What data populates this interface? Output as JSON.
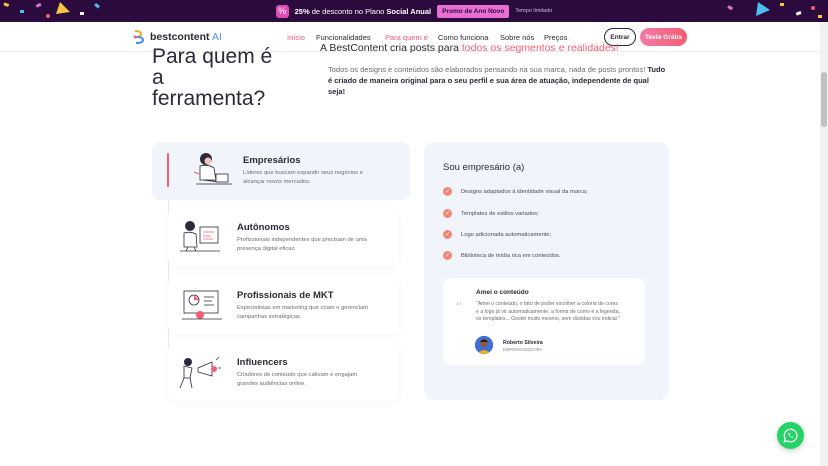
{
  "promo": {
    "text_pct": "25%",
    "text_mid": " de desconto no Plano ",
    "text_plan": "Social Anual",
    "button": "Promo de Ano Novo",
    "limited": "Tempo limitado"
  },
  "header": {
    "logo_name": "bestcontent",
    "logo_suffix": " AI",
    "nav": [
      {
        "label": "Início",
        "active": true
      },
      {
        "label": "Funcionalidades",
        "active": false
      },
      {
        "label": "Para quem é",
        "active": true
      },
      {
        "label": "Como funciona",
        "active": false
      },
      {
        "label": "Sobre nós",
        "active": false
      },
      {
        "label": "Preços",
        "active": false
      }
    ],
    "enter_label": "Entrar",
    "trial_label": "Teste Grátis"
  },
  "hero": {
    "title_l1": "Para quem é",
    "title_l2": "a",
    "title_l3": "ferramenta?",
    "cut_text": "A BestContent cria posts para ",
    "cut_highlight": "todos os segmentos e realidades!",
    "p1": "Todos os designs e conteúdos são elaborados pensando na sua marca, nada de posts prontos! ",
    "p1_bold": "Tudo",
    "p2": "é criado de maneira original para o seu perfil e sua área de atuação, independente de qual seja!"
  },
  "profiles": [
    {
      "title": "Empresários",
      "desc": "Líderes que buscam expandir seus negócios e alcançar novos mercados.",
      "icon": "person-laptop-illustration"
    },
    {
      "title": "Autônomos",
      "desc": "Profissionais independentes que precisam de uma presença digital eficaz.",
      "icon": "person-board-illustration"
    },
    {
      "title": "Profissionais de MKT",
      "desc": "Especialistas em marketing que criam e gerenciam campanhas estratégicas.",
      "icon": "marketing-illustration"
    },
    {
      "title": "Influencers",
      "desc": "Criadores de conteúdo que cativam e engajam grandes audiências online.",
      "icon": "megaphone-illustration"
    }
  ],
  "panel": {
    "title": "Sou empresário (a)",
    "features": [
      "Designs adaptados à identidade visual da marca;",
      "Templates de estilos variados;",
      "Logo adicionada automaticamente;",
      "Biblioteca de mídia rica em conteúdos."
    ],
    "testimonial": {
      "title": "Amei o conteúdo",
      "body": "\"Amei o conteúdo, o fato de poder escolher a coloria de cores e a logo já vir automaticamente, a forma de como é a legenda, os templates... Gostei muito mesmo, sem dúvidas vou indicar.\"",
      "name": "Roberto Silveira",
      "role": "EMPREENDEDORA"
    }
  },
  "colors": {
    "accent": "#f35e72",
    "panel_bg": "#f1f4fb",
    "promo_bg": "#2b0b3d",
    "whatsapp": "#25d366"
  }
}
